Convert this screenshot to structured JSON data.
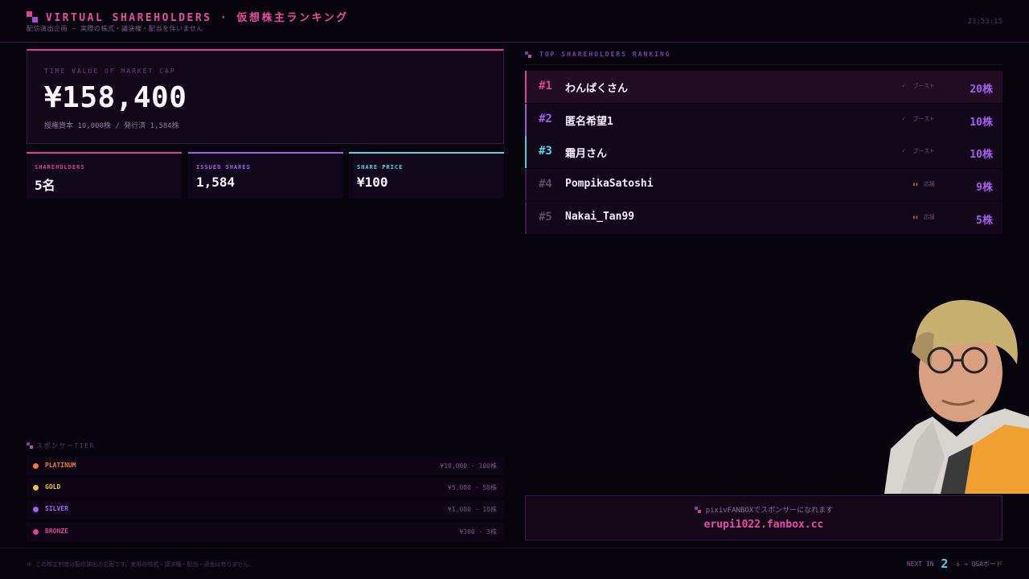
{
  "header": {
    "title": "VIRTUAL SHAREHOLDERS · 仮想株主ランキング",
    "subtitle": "配信演出企画 — 実際の株式・議決権・配当を伴いません",
    "clock": "23:53:15"
  },
  "market_cap": {
    "label": "TIME VALUE OF MARKET CAP",
    "value": "¥158,400",
    "note": "授権資本 10,000株 / 発行済 1,584株"
  },
  "stats": [
    {
      "label": "SHAREHOLDERS",
      "value": "5名",
      "color": "#e0409a"
    },
    {
      "label": "ISSUED SHARES",
      "value": "1,584",
      "color": "#a55ef0"
    },
    {
      "label": "SHARE PRICE",
      "value": "¥100",
      "color": "#4fd8e6"
    }
  ],
  "tiers": {
    "heading": "スポンサーTIER",
    "items": [
      {
        "name": "PLATINUM",
        "price": "¥10,000 · 100株",
        "color": "#f07a3a"
      },
      {
        "name": "GOLD",
        "price": "¥5,000 · 50株",
        "color": "#f0c040"
      },
      {
        "name": "SILVER",
        "price": "¥1,000 · 10株",
        "color": "#a55ef0"
      },
      {
        "name": "BRONZE",
        "price": "¥300 · 3株",
        "color": "#e0409a"
      }
    ]
  },
  "ranking": {
    "heading": "TOP SHAREHOLDERS RANKING",
    "rows": [
      {
        "rank": "#1",
        "name": "わんぱくさん",
        "tag": "ブースト",
        "icon": "rocket-icon",
        "shares": "20株",
        "rank_color": "#e0409a",
        "icon_glyph": "➶"
      },
      {
        "rank": "#2",
        "name": "匿名希望1",
        "tag": "ブースト",
        "icon": "rocket-icon",
        "shares": "10株",
        "rank_color": "#a55ef0",
        "icon_glyph": "➶"
      },
      {
        "rank": "#3",
        "name": "霜月さん",
        "tag": "ブースト",
        "icon": "rocket-icon",
        "shares": "10株",
        "rank_color": "#4fd8e6",
        "icon_glyph": "➶"
      },
      {
        "rank": "#4",
        "name": "PompikaSatoshi",
        "tag": "応援",
        "icon": "cheer-icon",
        "shares": "9株",
        "rank_color": "#5a4a66",
        "icon_glyph": "▮▮"
      },
      {
        "rank": "#5",
        "name": "Nakai_Tan99",
        "tag": "応援",
        "icon": "cheer-icon",
        "shares": "5株",
        "rank_color": "#5a4a66",
        "icon_glyph": "▮▮"
      }
    ]
  },
  "fanbox": {
    "label": "pixivFANBOXでスポンサーになれます",
    "url": "erupi1022.fanbox.cc"
  },
  "footer": {
    "note": "※ この株主制度は配信演出の企画です。実際の株式・議決権・配当・返金は有りません。",
    "next_prefix": "NEXT IN",
    "next_count": "2",
    "next_suffix": "s → Q&Aボード"
  }
}
